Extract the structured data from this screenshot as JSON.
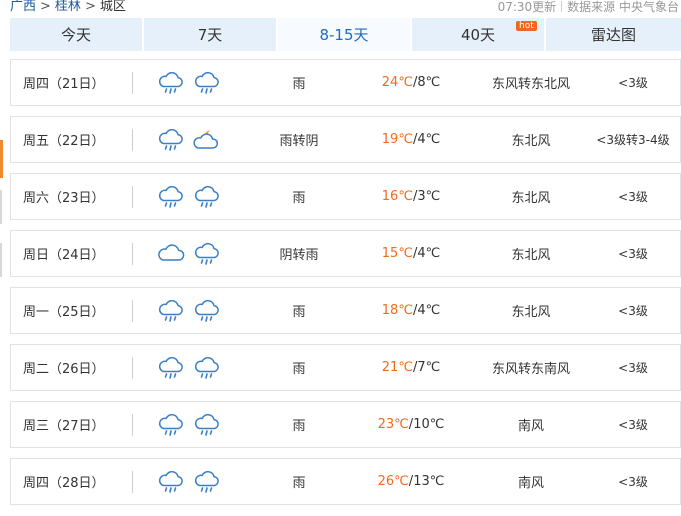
{
  "breadcrumb": {
    "province": "广西",
    "city": "桂林",
    "district": "城区",
    "separator": ">"
  },
  "meta": {
    "update": "07:30更新",
    "source": "数据来源 中央气象台"
  },
  "tabs": [
    {
      "label": "今天",
      "active": false
    },
    {
      "label": "7天",
      "active": false
    },
    {
      "label": "8-15天",
      "active": true
    },
    {
      "label": "40天",
      "active": false,
      "badge": "hot"
    },
    {
      "label": "雷达图",
      "active": false
    }
  ],
  "colors": {
    "accent": "#1e6bbf",
    "temp_high": "#f26a1b",
    "tab_bg": "#e6f0fa",
    "badge": "#f2681a",
    "side_marker": "#f08a2c"
  },
  "forecast": [
    {
      "day": "周四（21日）",
      "icons": [
        "rain-cloud-icon",
        "rain-cloud-icon"
      ],
      "desc": "雨",
      "high": "24℃",
      "low": "8℃",
      "wind": "东风转东北风",
      "level": "<3级"
    },
    {
      "day": "周五（22日）",
      "icons": [
        "rain-cloud-icon",
        "moon-cloud-icon"
      ],
      "desc": "雨转阴",
      "high": "19℃",
      "low": "4℃",
      "wind": "东北风",
      "level": "<3级转3-4级"
    },
    {
      "day": "周六（23日）",
      "icons": [
        "rain-cloud-icon",
        "rain-cloud-icon"
      ],
      "desc": "雨",
      "high": "16℃",
      "low": "3℃",
      "wind": "东北风",
      "level": "<3级"
    },
    {
      "day": "周日（24日）",
      "icons": [
        "cloud-icon",
        "rain-cloud-icon"
      ],
      "desc": "阴转雨",
      "high": "15℃",
      "low": "4℃",
      "wind": "东北风",
      "level": "<3级"
    },
    {
      "day": "周一（25日）",
      "icons": [
        "rain-cloud-icon",
        "rain-cloud-icon"
      ],
      "desc": "雨",
      "high": "18℃",
      "low": "4℃",
      "wind": "东北风",
      "level": "<3级"
    },
    {
      "day": "周二（26日）",
      "icons": [
        "rain-cloud-icon",
        "rain-cloud-icon"
      ],
      "desc": "雨",
      "high": "21℃",
      "low": "7℃",
      "wind": "东风转东南风",
      "level": "<3级"
    },
    {
      "day": "周三（27日）",
      "icons": [
        "rain-cloud-icon",
        "rain-cloud-icon"
      ],
      "desc": "雨",
      "high": "23℃",
      "low": "10℃",
      "wind": "南风",
      "level": "<3级"
    },
    {
      "day": "周四（28日）",
      "icons": [
        "rain-cloud-icon",
        "rain-cloud-icon"
      ],
      "desc": "雨",
      "high": "26℃",
      "low": "13℃",
      "wind": "南风",
      "level": "<3级"
    }
  ]
}
